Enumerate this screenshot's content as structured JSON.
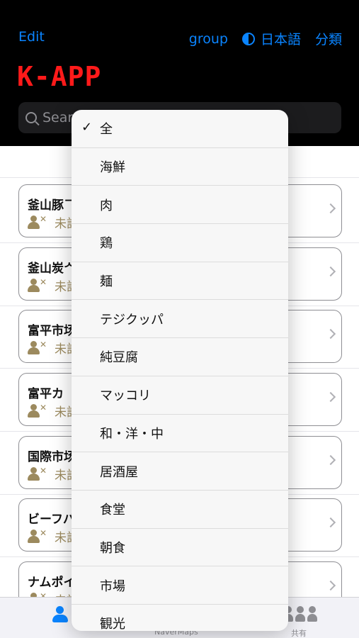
{
  "nav": {
    "edit": "Edit",
    "group": "group",
    "language": "日本語",
    "category": "分類"
  },
  "app_title": "K-APP",
  "search": {
    "placeholder": "Sear"
  },
  "cards": [
    {
      "name": "釜山豚ᄀ",
      "status": "未訂"
    },
    {
      "name": "釜山炭ᄼ",
      "status": "未訂"
    },
    {
      "name": "富平市场",
      "status": "未訂"
    },
    {
      "name": "富平カ",
      "status": "未訂"
    },
    {
      "name": "国際市场",
      "status": "未訂"
    },
    {
      "name": "ビーフバ",
      "status": "未訂"
    },
    {
      "name": "ナムポイ",
      "status": "未訂"
    }
  ],
  "tabbar": {
    "naver": "NaverMaps",
    "share": "共有"
  },
  "menu": {
    "selected": "全",
    "items": [
      "全",
      "海鮮",
      "肉",
      "鶏",
      "麺",
      "テジクッパ",
      "純豆腐",
      "マッコリ",
      "和・洋・中",
      "居酒屋",
      "食堂",
      "朝食",
      "市場",
      "観光"
    ]
  },
  "colors": {
    "accent": "#0a84ff",
    "title": "#ff1a1a",
    "status": "#9c8a5e"
  }
}
